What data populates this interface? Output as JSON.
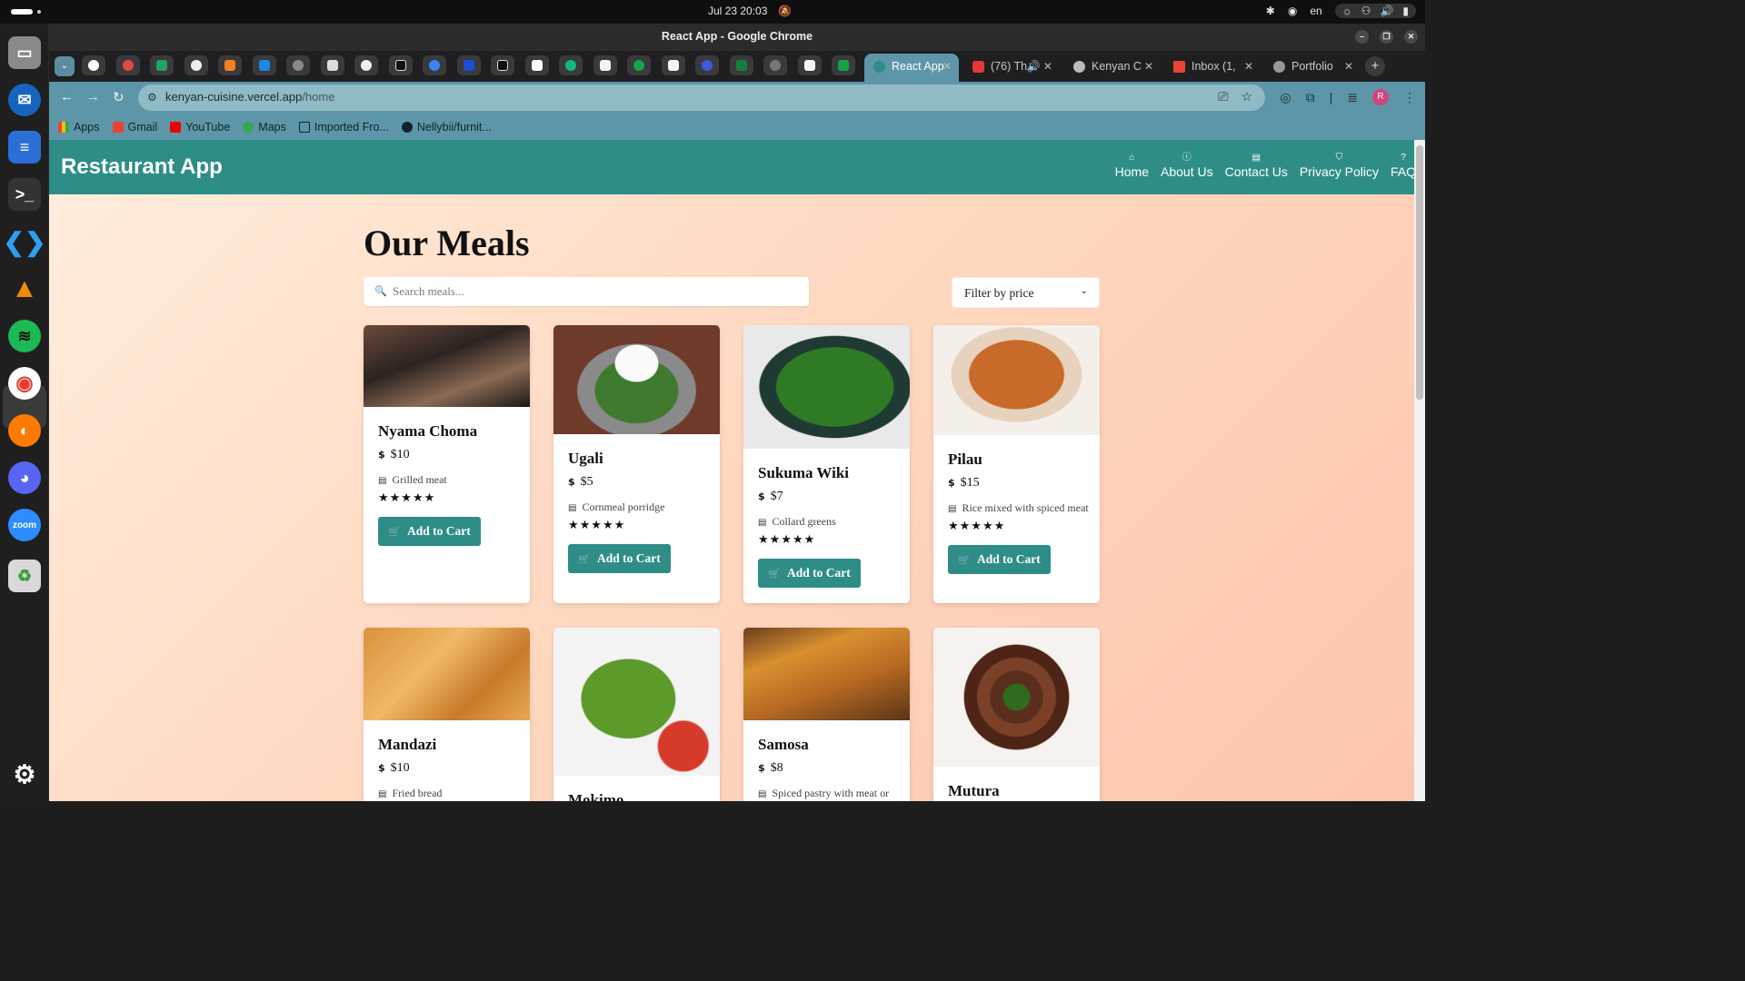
{
  "system": {
    "clock": "Jul 23  20:03",
    "lang": "en"
  },
  "window": {
    "title": "React App - Google Chrome"
  },
  "tabs": [
    {
      "label": "React App",
      "active": true
    },
    {
      "label": "(76) Th",
      "active": false
    },
    {
      "label": "Kenyan C",
      "active": false
    },
    {
      "label": "Inbox (1,",
      "active": false
    },
    {
      "label": "Portfolio",
      "active": false
    }
  ],
  "address": {
    "host": "kenyan-cuisine.vercel.app",
    "path": "/home"
  },
  "bookmarks": [
    "Apps",
    "Gmail",
    "YouTube",
    "Maps",
    "Imported Fro...",
    "Nellybii/furnit..."
  ],
  "app": {
    "brand": "Restaurant App",
    "nav": [
      "Home",
      "About Us",
      "Contact Us",
      "Privacy Policy",
      "FAQ"
    ],
    "heading": "Our Meals",
    "search_placeholder": "Search meals...",
    "filter_label": "Filter by price",
    "cart_label": "Add to Cart",
    "stars": "★★★★★",
    "meals": [
      {
        "name": "Nyama Choma",
        "price": "$10",
        "desc": "Grilled meat",
        "rating": 5
      },
      {
        "name": "Ugali",
        "price": "$5",
        "desc": "Cornmeal porridge",
        "rating": 5
      },
      {
        "name": "Sukuma Wiki",
        "price": "$7",
        "desc": "Collard greens",
        "rating": 5
      },
      {
        "name": "Pilau",
        "price": "$15",
        "desc": "Rice mixed with spiced meat",
        "rating": 5
      },
      {
        "name": "Mandazi",
        "price": "$10",
        "desc": "Fried bread"
      },
      {
        "name": "Mokimo",
        "price": "",
        "desc": ""
      },
      {
        "name": "Samosa",
        "price": "$8",
        "desc": "Spiced pastry with meat or"
      },
      {
        "name": "Mutura",
        "price": "",
        "desc": ""
      }
    ]
  }
}
